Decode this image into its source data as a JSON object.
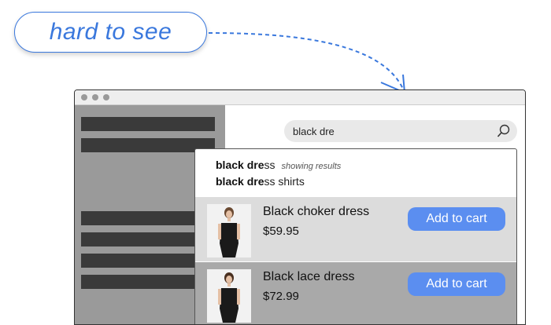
{
  "callout": {
    "label": "hard to see"
  },
  "search": {
    "query": "black dre"
  },
  "suggestions": [
    {
      "match": "black dre",
      "rest": "ss",
      "hint": "showing results"
    },
    {
      "match": "black dre",
      "rest": "ss shirts"
    }
  ],
  "results": [
    {
      "name": "Black choker dress",
      "price": "$59.95",
      "button": "Add to cart"
    },
    {
      "name": "Black lace dress",
      "price": "$72.99",
      "button": "Add to cart"
    }
  ],
  "colors": {
    "accent": "#3a78dd",
    "button": "#5b8ef0",
    "sidebar": "#9a9a9a"
  }
}
